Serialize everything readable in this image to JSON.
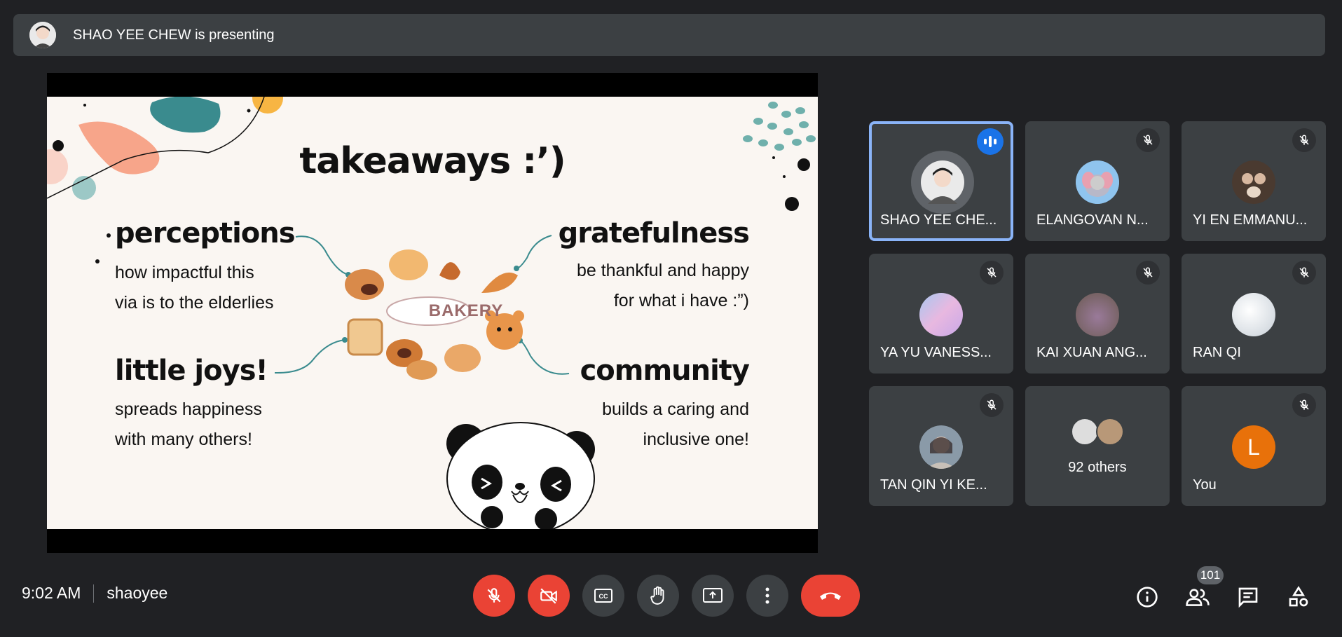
{
  "banner": {
    "text": "SHAO YEE CHEW is presenting"
  },
  "slide": {
    "title": "takeaways :’)",
    "sections": [
      {
        "heading": "perceptions",
        "line1": "how impactful this",
        "line2": "via is to the elderlies"
      },
      {
        "heading": "gratefulness",
        "line1": "be thankful and happy",
        "line2": "for what i have :”)"
      },
      {
        "heading": "little joys!",
        "line1": "spreads happiness",
        "line2": "with many others!"
      },
      {
        "heading": "community",
        "line1": "builds a caring and",
        "line2": "inclusive one!"
      }
    ],
    "center_label": "BAKERY"
  },
  "participants": [
    {
      "name": "SHAO YEE CHE...",
      "speaking": true
    },
    {
      "name": "ELANGOVAN N...",
      "muted": true
    },
    {
      "name": "YI EN EMMANU...",
      "muted": true
    },
    {
      "name": "YA YU VANESS...",
      "muted": true
    },
    {
      "name": "KAI XUAN ANG...",
      "muted": true
    },
    {
      "name": "RAN QI",
      "muted": true
    },
    {
      "name": "TAN QIN YI KE...",
      "muted": true
    },
    {
      "name": "92 others"
    },
    {
      "name": "You",
      "initial": "L",
      "muted": true
    }
  ],
  "footer": {
    "time": "9:02 AM",
    "meeting_code": "shaoyee",
    "people_count": "101"
  },
  "colors": {
    "accent_blue": "#1a73e8",
    "end_red": "#ea4335",
    "tile_bg": "#3c4043",
    "you_avatar": "#e8710a"
  }
}
